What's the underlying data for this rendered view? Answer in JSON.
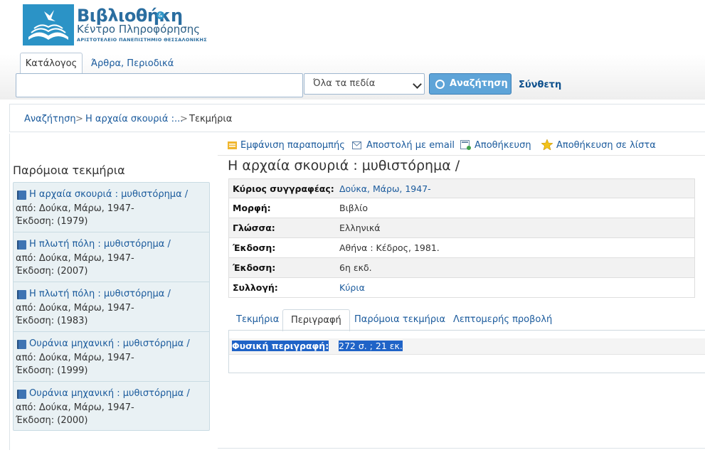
{
  "header": {
    "logo_title": "Βιβλιοθήκη",
    "logo_subtitle": "Κέντρο Πληροφόρησης",
    "logo_university": "ΑΡΙΣΤΟΤΕΛΕΙΟ ΠΑΝΕΠΙΣΤΗΜΙΟ ΘΕΣΣΑΛΟΝΙΚΗΣ",
    "logo_amp": "&",
    "tabs": [
      {
        "label": "Κατάλογος",
        "active": true
      },
      {
        "label": "Άρθρα, Περιοδικά",
        "active": false
      }
    ],
    "search": {
      "value": "",
      "placeholder": ""
    },
    "field_select": {
      "selected": "Όλα τα πεδία"
    },
    "search_button": "Αναζήτηση",
    "advanced_link": "Σύνθετη"
  },
  "breadcrumb": {
    "items": [
      "Αναζήτηση",
      "Η αρχαία σκουριά :...",
      "Τεκμήρια"
    ],
    "separator": ">"
  },
  "sidebar": {
    "heading": "Παρόμοια τεκμήρια",
    "items": [
      {
        "title": "Η αρχαία σκουριά : μυθιστόρημα /",
        "author": "από: Δούκα, Μάρω, 1947-",
        "edition": "Έκδοση: (1979)"
      },
      {
        "title": "Η πλωτή πόλη : μυθιστόρημα /",
        "author": "από: Δούκα, Μάρω, 1947-",
        "edition": "Έκδοση: (2007)"
      },
      {
        "title": "Η πλωτή πόλη : μυθιστόρημα /",
        "author": "από: Δούκα, Μάρω, 1947-",
        "edition": "Έκδοση: (1983)"
      },
      {
        "title": "Ουράνια μηχανική : μυθιστόρημα /",
        "author": "από: Δούκα, Μάρω, 1947-",
        "edition": "Έκδοση: (1999)"
      },
      {
        "title": "Ουράνια μηχανική : μυθιστόρημα /",
        "author": "από: Δούκα, Μάρω, 1947-",
        "edition": "Έκδοση: (2000)"
      }
    ]
  },
  "toolbar": {
    "cite": "Εμφάνιση παραπομπής",
    "email": "Αποστολή με email",
    "save": "Αποθήκευση",
    "save_list": "Αποθήκευση σε λίστα"
  },
  "record": {
    "title": "Η αρχαία σκουριά : μυθιστόρημα /",
    "rows": [
      {
        "label": "Κύριος συγγραφέας:",
        "value": "Δούκα, Μάρω, 1947-",
        "link": true
      },
      {
        "label": "Μορφή:",
        "value": "Βιβλίο",
        "link": false
      },
      {
        "label": "Γλώσσα:",
        "value": "Ελληνικά",
        "link": false
      },
      {
        "label": "Έκδοση:",
        "value": "Αθήνα : Κέδρος, 1981.",
        "link": false
      },
      {
        "label": "Έκδοση:",
        "value": "6η εκδ.",
        "link": false
      },
      {
        "label": "Συλλογή:",
        "value": "Κύρια",
        "link": true
      }
    ]
  },
  "detail_tabs": {
    "tabs": [
      {
        "label": "Τεκμήρια",
        "active": false
      },
      {
        "label": "Περιγραφή",
        "active": true
      },
      {
        "label": "Παρόμοια τεκμήρια",
        "active": false
      },
      {
        "label": "Λεπτομερής προβολή",
        "active": false
      }
    ],
    "description": {
      "label": "Φυσική περιγραφή:",
      "value": "272 σ. ; 21 εκ."
    }
  },
  "colors": {
    "link": "#1a5a9c",
    "search_button": "#5ea4d8",
    "highlight": "#1f63c7",
    "sidebar_bg": "#e9f1f4"
  }
}
